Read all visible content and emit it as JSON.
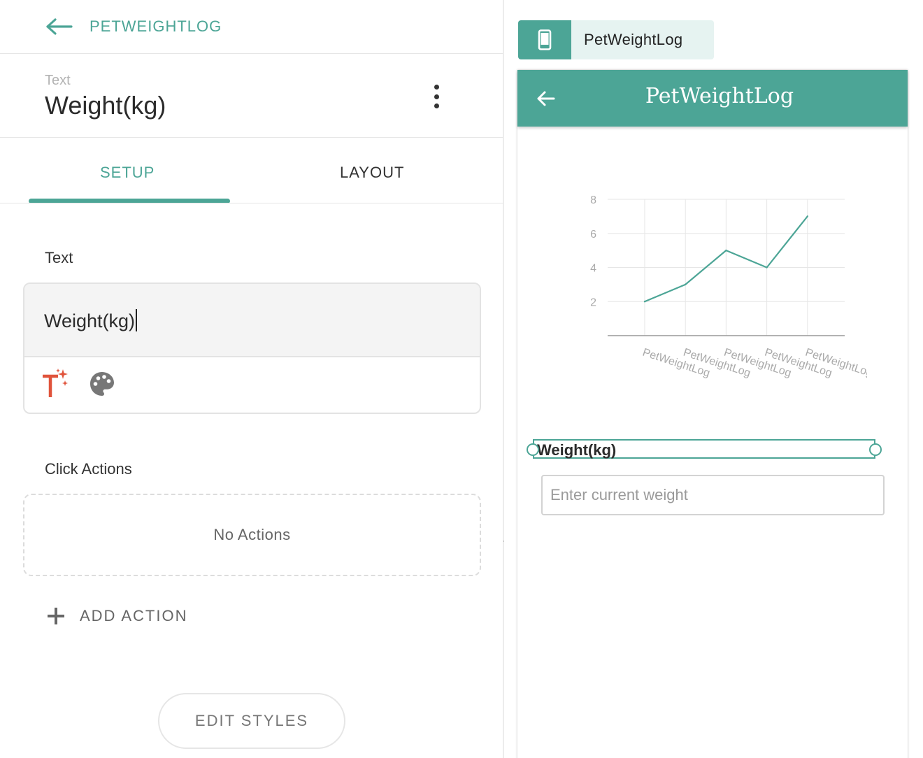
{
  "nav": {
    "back_label": "PETWEIGHTLOG"
  },
  "component": {
    "type_label": "Text",
    "name": "Weight(kg)"
  },
  "tabs": [
    {
      "label": "SETUP",
      "active": true
    },
    {
      "label": "LAYOUT",
      "active": false
    }
  ],
  "text_section": {
    "label": "Text",
    "value": "Weight(kg)"
  },
  "click_actions": {
    "label": "Click Actions",
    "empty_text": "No Actions",
    "add_label": "ADD ACTION"
  },
  "edit_styles_label": "EDIT STYLES",
  "preview": {
    "device_label": "PetWeightLog",
    "app_title": "PetWeightLog",
    "selected_text": "Weight(kg)",
    "input_placeholder": "Enter current weight"
  },
  "colors": {
    "accent": "#4ca596",
    "accent_light": "#e6f3f1",
    "magic_icon": "#e0533b",
    "palette_icon": "#777777"
  },
  "icons": {
    "back": "arrow-left-icon",
    "more": "more-vertical-icon",
    "magic_text": "magic-text-icon",
    "palette": "palette-icon",
    "add": "plus-icon",
    "device": "phone-icon"
  },
  "chart_data": {
    "type": "line",
    "categories": [
      "PetWeightLog",
      "PetWeightLog",
      "PetWeightLog",
      "PetWeightLog",
      "PetWeightLog"
    ],
    "values": [
      2,
      3,
      5,
      4,
      7
    ],
    "yticks": [
      2,
      4,
      6,
      8
    ],
    "ylim": [
      0,
      8
    ],
    "grid": true,
    "color": "#4ca596"
  }
}
